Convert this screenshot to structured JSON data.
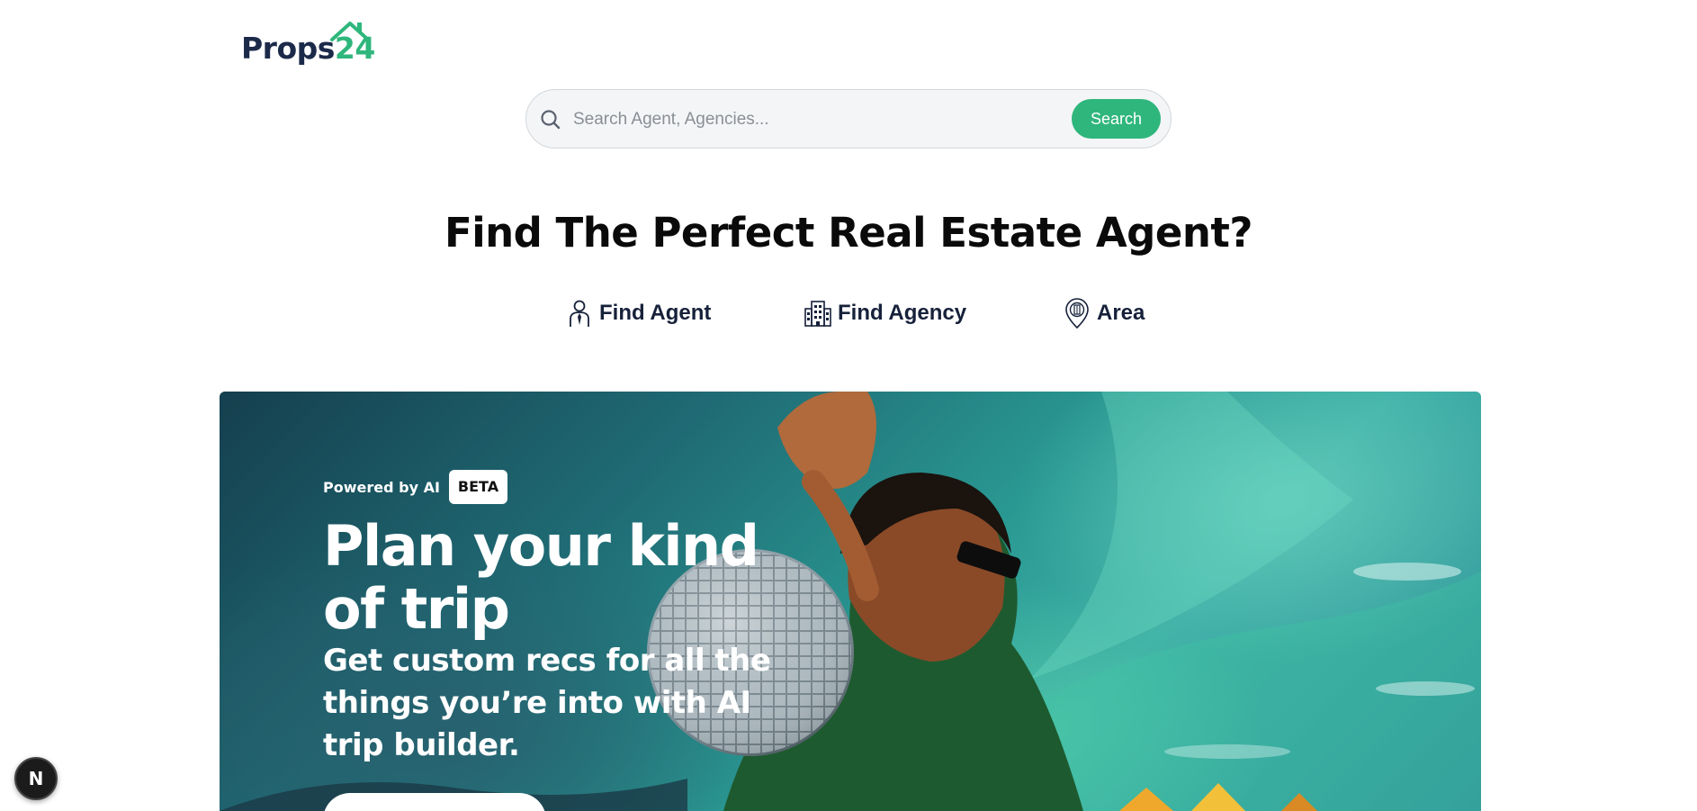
{
  "brand": {
    "name_part1": "Props",
    "name_part2": "24",
    "primary_color": "#1c2a4a",
    "accent_color": "#2fb67c"
  },
  "search": {
    "placeholder": "Search Agent, Agencies...",
    "button_label": "Search"
  },
  "headline": "Find The Perfect Real Estate Agent?",
  "tabs": [
    {
      "label": "Find Agent",
      "icon": "agent-icon"
    },
    {
      "label": "Find Agency",
      "icon": "building-icon"
    },
    {
      "label": "Area",
      "icon": "map-pin-icon"
    }
  ],
  "banner": {
    "powered_by": "Powered by AI",
    "badge": "BETA",
    "title": "Plan your kind of trip",
    "subtitle": "Get custom recs for all the things you’re into with AI trip builder."
  },
  "dev_badge": {
    "label": "N"
  }
}
